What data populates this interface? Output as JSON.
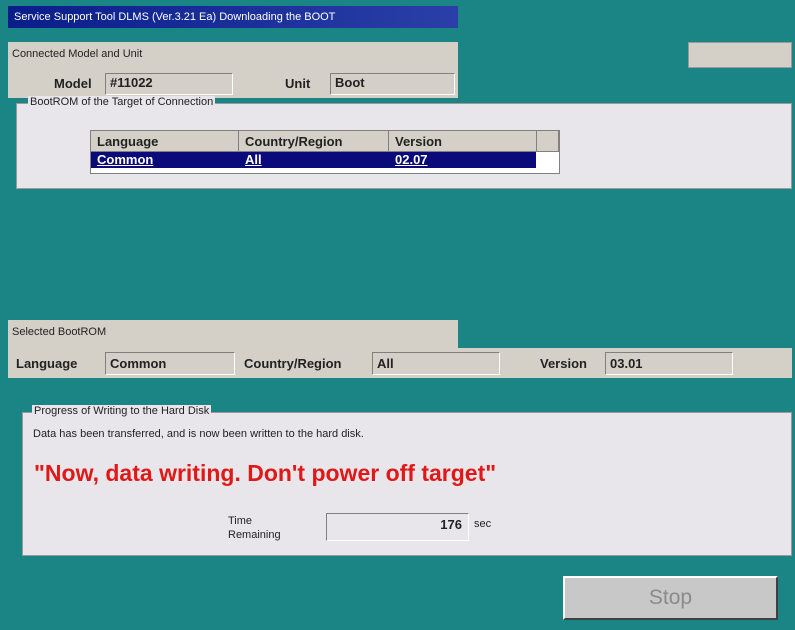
{
  "window": {
    "title": "Service Support Tool DLMS (Ver.3.21 Ea) Downloading the BOOT"
  },
  "connected": {
    "section_label": "Connected Model and Unit",
    "model_label": "Model",
    "model_value": "#11022",
    "unit_label": "Unit",
    "unit_value": "Boot"
  },
  "bootrom_target": {
    "group_title": "BootROM of the Target of Connection",
    "columns": [
      "Language",
      "Country/Region",
      "Version"
    ],
    "rows": [
      {
        "language": "Common",
        "country": "All",
        "version": "02.07"
      }
    ]
  },
  "selected": {
    "section_label": "Selected BootROM",
    "language_label": "Language",
    "language_value": "Common",
    "country_label": "Country/Region",
    "country_value": "All",
    "version_label": "Version",
    "version_value": "03.01"
  },
  "progress": {
    "group_title": "Progress of Writing to the Hard Disk",
    "message": "Data has been transferred, and is now been written to the hard disk.",
    "warning": "\"Now, data writing. Don't power off target\"",
    "time_label_line1": "Time",
    "time_label_line2": "Remaining",
    "time_value": "176",
    "time_unit": "sec"
  },
  "buttons": {
    "stop_label": "Stop"
  },
  "colors": {
    "background": "#1a8584",
    "selection": "#0a0a7a",
    "warning": "#e01818"
  }
}
